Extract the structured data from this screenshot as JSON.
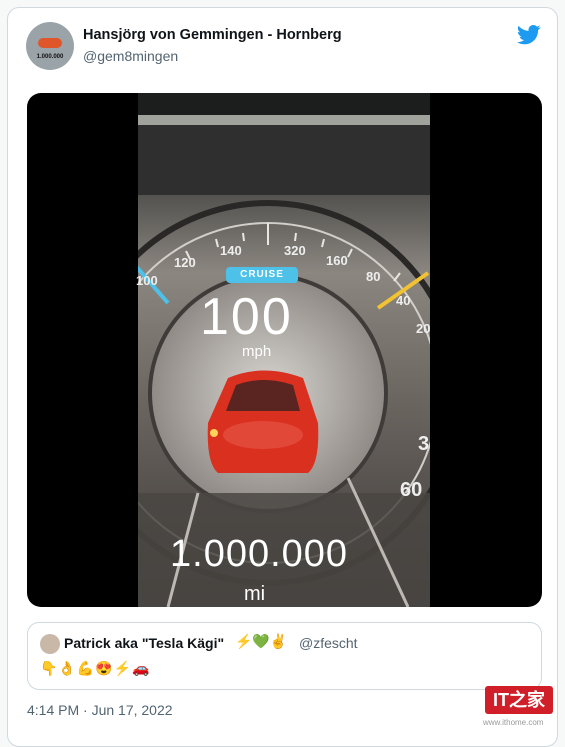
{
  "author": {
    "name": "Hansjörg von Gemmingen - Hornberg",
    "handle": "@gem8mingen",
    "avatar_text": "1.000.000"
  },
  "media": {
    "cruise_label": "CRUISE",
    "speed": "100",
    "speed_unit": "mph",
    "odometer": "1.000.000",
    "odometer_unit": "mi",
    "ticks_left": [
      "100",
      "120",
      "140",
      "320"
    ],
    "ticks_right": [
      "160",
      "80",
      "40",
      "20",
      "3",
      "60"
    ]
  },
  "quote": {
    "name": "Patrick aka \"Tesla Kägi\"",
    "name_emoji": "⚡💚✌️",
    "handle": "@zfescht",
    "text": "👇👌💪😍⚡🚗"
  },
  "timestamp": "4:14 PM · Jun 17, 2022",
  "watermark": {
    "logo": "IT之家",
    "url": "www.ithome.com"
  },
  "colors": {
    "accent": "#1d9bf0",
    "cruise": "#4ec1e8",
    "car": "#d93020"
  }
}
